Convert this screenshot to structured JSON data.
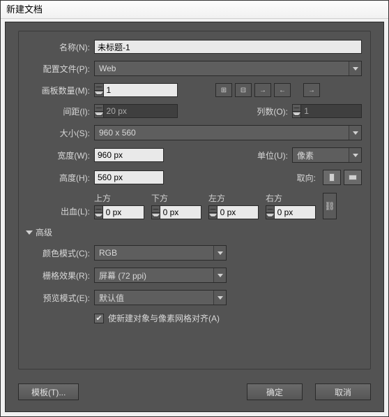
{
  "window": {
    "title": "新建文档"
  },
  "name": {
    "label": "名称(N):",
    "value": "未标题-1"
  },
  "profile": {
    "label": "配置文件(P):",
    "value": "Web"
  },
  "artboards": {
    "count": {
      "label": "画板数量(M):",
      "value": "1"
    },
    "spacing": {
      "label": "间距(I):",
      "value": "20 px"
    },
    "columns": {
      "label": "列数(O):",
      "value": "1"
    }
  },
  "size": {
    "label": "大小(S):",
    "value": "960 x 560"
  },
  "width": {
    "label": "宽度(W):",
    "value": "960 px"
  },
  "height": {
    "label": "高度(H):",
    "value": "560 px"
  },
  "units": {
    "label": "单位(U):",
    "value": "像素"
  },
  "orient": {
    "label": "取向:"
  },
  "bleed": {
    "label": "出血(L):",
    "top": {
      "label": "上方",
      "value": "0 px"
    },
    "bottom": {
      "label": "下方",
      "value": "0 px"
    },
    "left": {
      "label": "左方",
      "value": "0 px"
    },
    "right": {
      "label": "右方",
      "value": "0 px"
    }
  },
  "advanced": {
    "title": "高级",
    "colorMode": {
      "label": "颜色模式(C):",
      "value": "RGB"
    },
    "rasterEffect": {
      "label": "栅格效果(R):",
      "value": "屏幕 (72 ppi)"
    },
    "previewMode": {
      "label": "预览模式(E):",
      "value": "默认值"
    },
    "align": {
      "label": "使新建对象与像素网格对齐(A)"
    }
  },
  "footer": {
    "templates": "模板(T)...",
    "ok": "确定",
    "cancel": "取消"
  }
}
